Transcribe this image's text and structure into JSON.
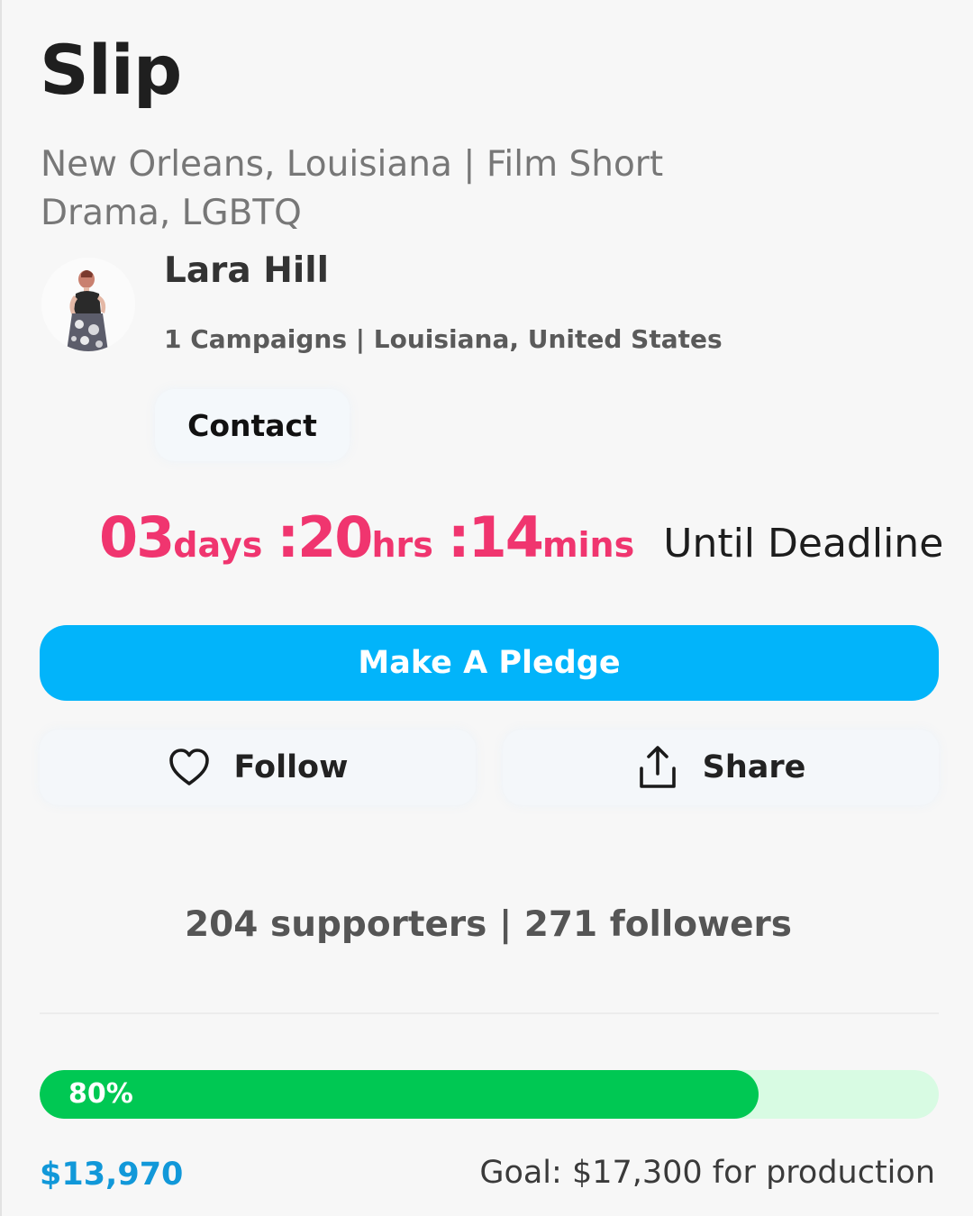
{
  "campaign": {
    "title": "Slip",
    "location_line": "New Orleans, Louisiana | Film Short",
    "genres_line": "Drama, LGBTQ"
  },
  "creator": {
    "name": "Lara Hill",
    "meta": "1 Campaigns | Louisiana, United States",
    "contact_label": "Contact"
  },
  "countdown": {
    "days": "03",
    "days_unit": "days",
    "hours": ":20",
    "hours_unit": "hrs",
    "minutes": ":14",
    "minutes_unit": "mins",
    "suffix": "Until Deadline"
  },
  "actions": {
    "pledge_label": "Make A Pledge",
    "follow_label": "Follow",
    "follow_icon": "heart-icon",
    "share_label": "Share",
    "share_icon": "share-icon"
  },
  "stats": {
    "text": "204 supporters | 271 followers"
  },
  "funding": {
    "percent": 80,
    "percent_label": "80%",
    "raised": "$13,970",
    "goal_text": "Goal: $17,300 for production"
  },
  "colors": {
    "accent_blue": "#02b4fa",
    "countdown_pink": "#f0356f",
    "progress_green": "#00c853",
    "progress_track": "#d8fbe3",
    "raised_blue": "#1198d9"
  }
}
